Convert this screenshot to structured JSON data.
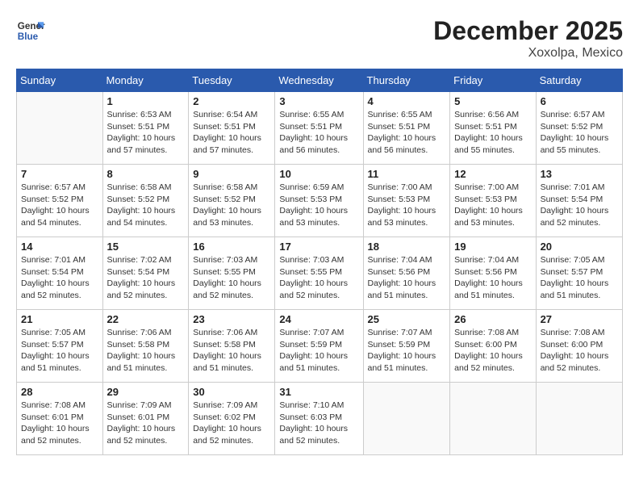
{
  "header": {
    "logo_line1": "General",
    "logo_line2": "Blue",
    "month": "December 2025",
    "location": "Xoxolpa, Mexico"
  },
  "weekdays": [
    "Sunday",
    "Monday",
    "Tuesday",
    "Wednesday",
    "Thursday",
    "Friday",
    "Saturday"
  ],
  "weeks": [
    [
      {
        "day": "",
        "info": ""
      },
      {
        "day": "1",
        "info": "Sunrise: 6:53 AM\nSunset: 5:51 PM\nDaylight: 10 hours\nand 57 minutes."
      },
      {
        "day": "2",
        "info": "Sunrise: 6:54 AM\nSunset: 5:51 PM\nDaylight: 10 hours\nand 57 minutes."
      },
      {
        "day": "3",
        "info": "Sunrise: 6:55 AM\nSunset: 5:51 PM\nDaylight: 10 hours\nand 56 minutes."
      },
      {
        "day": "4",
        "info": "Sunrise: 6:55 AM\nSunset: 5:51 PM\nDaylight: 10 hours\nand 56 minutes."
      },
      {
        "day": "5",
        "info": "Sunrise: 6:56 AM\nSunset: 5:51 PM\nDaylight: 10 hours\nand 55 minutes."
      },
      {
        "day": "6",
        "info": "Sunrise: 6:57 AM\nSunset: 5:52 PM\nDaylight: 10 hours\nand 55 minutes."
      }
    ],
    [
      {
        "day": "7",
        "info": "Sunrise: 6:57 AM\nSunset: 5:52 PM\nDaylight: 10 hours\nand 54 minutes."
      },
      {
        "day": "8",
        "info": "Sunrise: 6:58 AM\nSunset: 5:52 PM\nDaylight: 10 hours\nand 54 minutes."
      },
      {
        "day": "9",
        "info": "Sunrise: 6:58 AM\nSunset: 5:52 PM\nDaylight: 10 hours\nand 53 minutes."
      },
      {
        "day": "10",
        "info": "Sunrise: 6:59 AM\nSunset: 5:53 PM\nDaylight: 10 hours\nand 53 minutes."
      },
      {
        "day": "11",
        "info": "Sunrise: 7:00 AM\nSunset: 5:53 PM\nDaylight: 10 hours\nand 53 minutes."
      },
      {
        "day": "12",
        "info": "Sunrise: 7:00 AM\nSunset: 5:53 PM\nDaylight: 10 hours\nand 53 minutes."
      },
      {
        "day": "13",
        "info": "Sunrise: 7:01 AM\nSunset: 5:54 PM\nDaylight: 10 hours\nand 52 minutes."
      }
    ],
    [
      {
        "day": "14",
        "info": "Sunrise: 7:01 AM\nSunset: 5:54 PM\nDaylight: 10 hours\nand 52 minutes."
      },
      {
        "day": "15",
        "info": "Sunrise: 7:02 AM\nSunset: 5:54 PM\nDaylight: 10 hours\nand 52 minutes."
      },
      {
        "day": "16",
        "info": "Sunrise: 7:03 AM\nSunset: 5:55 PM\nDaylight: 10 hours\nand 52 minutes."
      },
      {
        "day": "17",
        "info": "Sunrise: 7:03 AM\nSunset: 5:55 PM\nDaylight: 10 hours\nand 52 minutes."
      },
      {
        "day": "18",
        "info": "Sunrise: 7:04 AM\nSunset: 5:56 PM\nDaylight: 10 hours\nand 51 minutes."
      },
      {
        "day": "19",
        "info": "Sunrise: 7:04 AM\nSunset: 5:56 PM\nDaylight: 10 hours\nand 51 minutes."
      },
      {
        "day": "20",
        "info": "Sunrise: 7:05 AM\nSunset: 5:57 PM\nDaylight: 10 hours\nand 51 minutes."
      }
    ],
    [
      {
        "day": "21",
        "info": "Sunrise: 7:05 AM\nSunset: 5:57 PM\nDaylight: 10 hours\nand 51 minutes."
      },
      {
        "day": "22",
        "info": "Sunrise: 7:06 AM\nSunset: 5:58 PM\nDaylight: 10 hours\nand 51 minutes."
      },
      {
        "day": "23",
        "info": "Sunrise: 7:06 AM\nSunset: 5:58 PM\nDaylight: 10 hours\nand 51 minutes."
      },
      {
        "day": "24",
        "info": "Sunrise: 7:07 AM\nSunset: 5:59 PM\nDaylight: 10 hours\nand 51 minutes."
      },
      {
        "day": "25",
        "info": "Sunrise: 7:07 AM\nSunset: 5:59 PM\nDaylight: 10 hours\nand 51 minutes."
      },
      {
        "day": "26",
        "info": "Sunrise: 7:08 AM\nSunset: 6:00 PM\nDaylight: 10 hours\nand 52 minutes."
      },
      {
        "day": "27",
        "info": "Sunrise: 7:08 AM\nSunset: 6:00 PM\nDaylight: 10 hours\nand 52 minutes."
      }
    ],
    [
      {
        "day": "28",
        "info": "Sunrise: 7:08 AM\nSunset: 6:01 PM\nDaylight: 10 hours\nand 52 minutes."
      },
      {
        "day": "29",
        "info": "Sunrise: 7:09 AM\nSunset: 6:01 PM\nDaylight: 10 hours\nand 52 minutes."
      },
      {
        "day": "30",
        "info": "Sunrise: 7:09 AM\nSunset: 6:02 PM\nDaylight: 10 hours\nand 52 minutes."
      },
      {
        "day": "31",
        "info": "Sunrise: 7:10 AM\nSunset: 6:03 PM\nDaylight: 10 hours\nand 52 minutes."
      },
      {
        "day": "",
        "info": ""
      },
      {
        "day": "",
        "info": ""
      },
      {
        "day": "",
        "info": ""
      }
    ]
  ]
}
